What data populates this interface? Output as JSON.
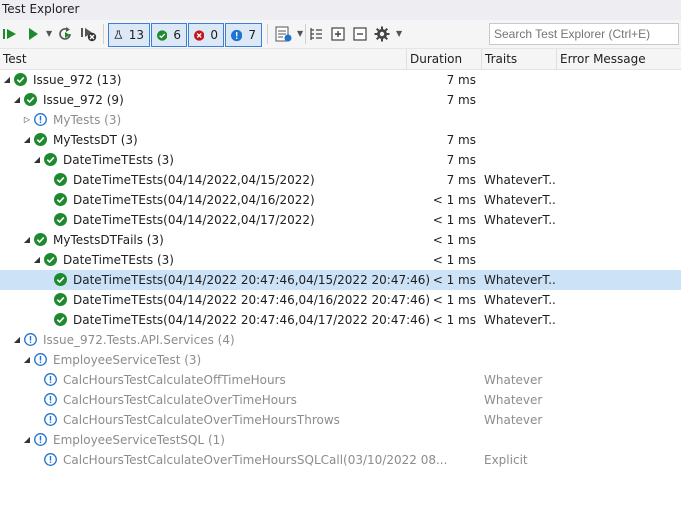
{
  "window": {
    "title": "Test Explorer"
  },
  "toolbar": {
    "counters": {
      "total": "13",
      "passed": "6",
      "failed": "0",
      "not_run": "7"
    },
    "search_placeholder": "Search Test Explorer (Ctrl+E)"
  },
  "columns": {
    "test": "Test",
    "duration": "Duration",
    "traits": "Traits",
    "error": "Error Message"
  },
  "colors": {
    "pass": "#1e8a2e",
    "notrun": "#1f74d1",
    "fail": "#c5161d",
    "accent": "#3d7fd6",
    "selected_row": "#cce2f7"
  },
  "rows": [
    {
      "name": "Issue_972  (13)",
      "duration": "7 ms",
      "traits": "",
      "status": "passed",
      "expander": "expanded",
      "muted": false,
      "selected": false
    },
    {
      "name": "Issue_972  (9)",
      "duration": "7 ms",
      "traits": "",
      "status": "passed",
      "expander": "expanded",
      "muted": false,
      "selected": false
    },
    {
      "name": "MyTests  (3)",
      "duration": "",
      "traits": "",
      "status": "notrun",
      "expander": "collapsed",
      "muted": true,
      "selected": false
    },
    {
      "name": "MyTestsDT  (3)",
      "duration": "7 ms",
      "traits": "",
      "status": "passed",
      "expander": "expanded",
      "muted": false,
      "selected": false
    },
    {
      "name": "DateTimeTEsts  (3)",
      "duration": "7 ms",
      "traits": "",
      "status": "passed",
      "expander": "expanded",
      "muted": false,
      "selected": false
    },
    {
      "name": "DateTimeTEsts(04/14/2022,04/15/2022)",
      "duration": "7 ms",
      "traits": "WhateverT...",
      "status": "passed",
      "expander": "none",
      "muted": false,
      "selected": false
    },
    {
      "name": "DateTimeTEsts(04/14/2022,04/16/2022)",
      "duration": "< 1 ms",
      "traits": "WhateverT...",
      "status": "passed",
      "expander": "none",
      "muted": false,
      "selected": false
    },
    {
      "name": "DateTimeTEsts(04/14/2022,04/17/2022)",
      "duration": "< 1 ms",
      "traits": "WhateverT...",
      "status": "passed",
      "expander": "none",
      "muted": false,
      "selected": false
    },
    {
      "name": "MyTestsDTFails  (3)",
      "duration": "< 1 ms",
      "traits": "",
      "status": "passed",
      "expander": "expanded",
      "muted": false,
      "selected": false
    },
    {
      "name": "DateTimeTEsts  (3)",
      "duration": "< 1 ms",
      "traits": "",
      "status": "passed",
      "expander": "expanded",
      "muted": false,
      "selected": false
    },
    {
      "name": "DateTimeTEsts(04/14/2022 20:47:46,04/15/2022 20:47:46)",
      "duration": "< 1 ms",
      "traits": "WhateverT...",
      "status": "passed",
      "expander": "none",
      "muted": false,
      "selected": true
    },
    {
      "name": "DateTimeTEsts(04/14/2022 20:47:46,04/16/2022 20:47:46)",
      "duration": "< 1 ms",
      "traits": "WhateverT...",
      "status": "passed",
      "expander": "none",
      "muted": false,
      "selected": false
    },
    {
      "name": "DateTimeTEsts(04/14/2022 20:47:46,04/17/2022 20:47:46)",
      "duration": "< 1 ms",
      "traits": "WhateverT...",
      "status": "passed",
      "expander": "none",
      "muted": false,
      "selected": false
    },
    {
      "name": "Issue_972.Tests.API.Services  (4)",
      "duration": "",
      "traits": "",
      "status": "notrun",
      "expander": "expanded",
      "muted": true,
      "selected": false
    },
    {
      "name": "EmployeeServiceTest  (3)",
      "duration": "",
      "traits": "",
      "status": "notrun",
      "expander": "expanded",
      "muted": true,
      "selected": false
    },
    {
      "name": "CalcHoursTestCalculateOffTimeHours",
      "duration": "",
      "traits": "Whatever",
      "status": "notrun",
      "expander": "none",
      "muted": true,
      "selected": false
    },
    {
      "name": "CalcHoursTestCalculateOverTimeHours",
      "duration": "",
      "traits": "Whatever",
      "status": "notrun",
      "expander": "none",
      "muted": true,
      "selected": false
    },
    {
      "name": "CalcHoursTestCalculateOverTimeHoursThrows",
      "duration": "",
      "traits": "Whatever",
      "status": "notrun",
      "expander": "none",
      "muted": true,
      "selected": false
    },
    {
      "name": "EmployeeServiceTestSQL  (1)",
      "duration": "",
      "traits": "",
      "status": "notrun",
      "expander": "expanded",
      "muted": true,
      "selected": false
    },
    {
      "name": "CalcHoursTestCalculateOverTimeHoursSQLCall(03/10/2022 08...",
      "duration": "",
      "traits": "Explicit",
      "status": "notrun",
      "expander": "none",
      "muted": true,
      "selected": false
    }
  ]
}
